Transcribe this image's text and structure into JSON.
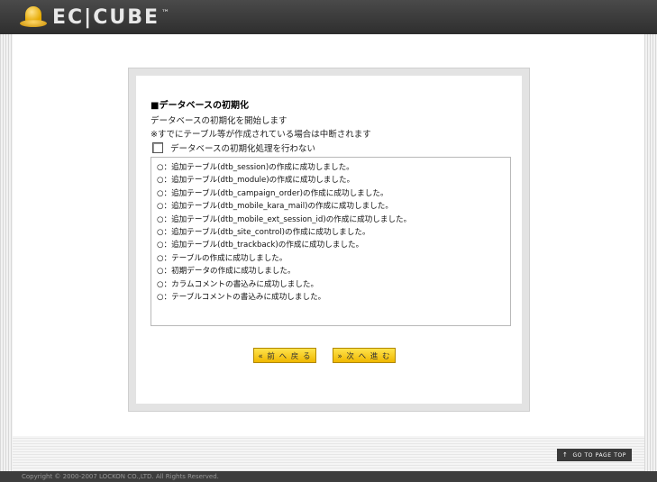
{
  "header": {
    "logo_text": "EC|CUBE",
    "logo_tm": "™"
  },
  "install": {
    "section_title": "■データベースの初期化",
    "description_1": "データベースの初期化を開始します",
    "description_2": "※すでにテーブル等が作成されている場合は中断されます",
    "skip_checkbox_label": "データベースの初期化処理を行わない",
    "skip_checked": false,
    "log_lines": [
      "○：追加テーブル(dtb_session)の作成に成功しました。",
      "○：追加テーブル(dtb_module)の作成に成功しました。",
      "○：追加テーブル(dtb_campaign_order)の作成に成功しました。",
      "○：追加テーブル(dtb_mobile_kara_mail)の作成に成功しました。",
      "○：追加テーブル(dtb_mobile_ext_session_id)の作成に成功しました。",
      "○：追加テーブル(dtb_site_control)の作成に成功しました。",
      "○：追加テーブル(dtb_trackback)の作成に成功しました。",
      "○：テーブルの作成に成功しました。",
      "○：初期データの作成に成功しました。",
      "○：カラムコメントの書込みに成功しました。",
      "○：テーブルコメントの書込みに成功しました。"
    ],
    "back_button_label": "« 前 へ 戻 る",
    "next_button_label": "» 次 へ 進 む"
  },
  "footer": {
    "page_top_label": "GO TO PAGE TOP",
    "page_top_arrow": "↑",
    "copyright": "Copyright © 2000-2007 LOCKON CO.,LTD. All Rights Reserved."
  },
  "colors": {
    "header_bg": "#3a3a3a",
    "button_yellow": "#f5cc1a",
    "logo_gold": "#e6a900"
  }
}
